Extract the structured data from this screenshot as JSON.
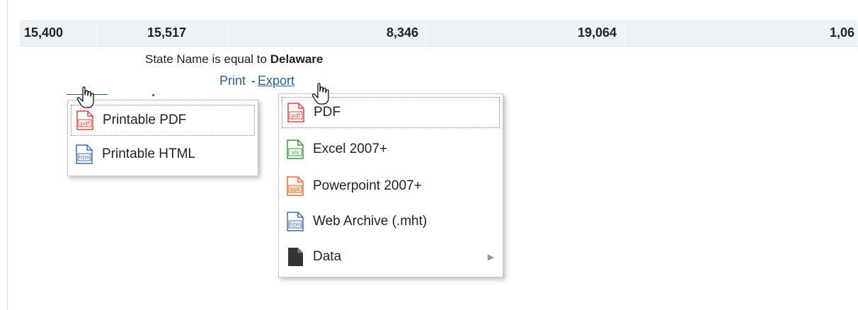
{
  "data_row": {
    "values": [
      "15,400",
      "15,517",
      "8,346",
      "19,064",
      "1,06"
    ]
  },
  "filter": {
    "prefix": "State Name is equal to",
    "value": "Delaware"
  },
  "links": {
    "print": "Print",
    "separator": "-",
    "export": "Export"
  },
  "print_menu": {
    "items": [
      {
        "label": "Printable PDF",
        "icon": "pdf-file-icon",
        "focused": true
      },
      {
        "label": "Printable HTML",
        "icon": "html-file-icon",
        "focused": false
      }
    ]
  },
  "export_menu": {
    "items": [
      {
        "label": "PDF",
        "icon": "pdf-file-icon",
        "focused": true
      },
      {
        "label": "Excel 2007+",
        "icon": "xls-file-icon",
        "focused": false
      },
      {
        "label": "Powerpoint 2007+",
        "icon": "ppt-file-icon",
        "focused": false
      },
      {
        "label": "Web Archive (.mht)",
        "icon": "html-file-icon",
        "focused": false
      },
      {
        "label": "Data",
        "icon": "data-file-icon",
        "focused": false,
        "has_submenu": true
      }
    ]
  },
  "icons": {
    "pdf": {
      "tag": "pdf",
      "color": "#e0453a"
    },
    "xls": {
      "tag": "xls",
      "color": "#3c9d3c"
    },
    "ppt": {
      "tag": "ppt",
      "color": "#e86a2c"
    },
    "htm": {
      "tag": "htm",
      "color": "#3b6fb6"
    },
    "data": {
      "color": "#333333"
    }
  },
  "colors": {
    "link": "#2c5f98",
    "row_bg": "#eef2f7"
  }
}
